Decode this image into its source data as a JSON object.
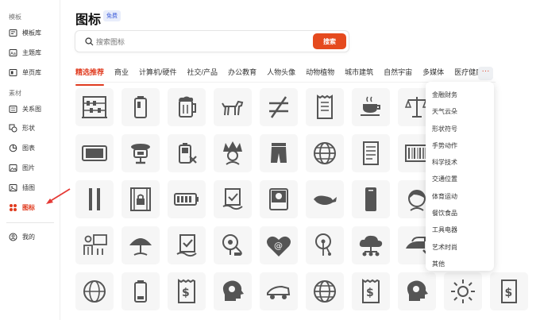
{
  "sidebar": {
    "section_templates": "模板",
    "section_materials": "素材",
    "items": [
      {
        "label": "模板库",
        "icon": "template-library-icon"
      },
      {
        "label": "主题库",
        "icon": "theme-library-icon"
      },
      {
        "label": "单页库",
        "icon": "single-page-icon"
      },
      {
        "label": "关系图",
        "icon": "relation-diagram-icon"
      },
      {
        "label": "形状",
        "icon": "shape-icon"
      },
      {
        "label": "图表",
        "icon": "chart-icon"
      },
      {
        "label": "图片",
        "icon": "image-icon"
      },
      {
        "label": "插图",
        "icon": "illustration-icon"
      },
      {
        "label": "图标",
        "icon": "icons-grid-icon",
        "active": true
      }
    ],
    "mine": {
      "label": "我的",
      "icon": "user-icon"
    }
  },
  "header": {
    "title": "图标",
    "badge": "免费"
  },
  "search": {
    "placeholder": "搜索图标",
    "button_label": "搜索"
  },
  "tabs": [
    "精选推荐",
    "商业",
    "计算机/硬件",
    "社交/产品",
    "办公教育",
    "人物头像",
    "动物植物",
    "城市建筑",
    "自然宇宙",
    "多媒体",
    "医疗健康"
  ],
  "more_label": "···",
  "dropdown_items": [
    "金融财务",
    "天气云朵",
    "形状符号",
    "手势动作",
    "科学技术",
    "交通位置",
    "体育运动",
    "餐饮食品",
    "工具电器",
    "艺术时尚",
    "其他"
  ],
  "colors": {
    "accent": "#e03b1f",
    "search_button": "#e54a1e",
    "icon_gray": "#555555",
    "tile_bg": "#f6f6f6"
  },
  "grid_icons": [
    [
      "abacus-icon",
      "battery-icon",
      "beer-mug-icon",
      "dog-icon",
      "not-equal-icon",
      "receipt-icon",
      "coffee-cup-icon",
      "scale-icon",
      "medal-icon"
    ],
    [
      "tablet-icon",
      "robot-icon",
      "battery-x-icon",
      "native-chief-icon",
      "shorts-icon",
      "globe-icon",
      "document-icon",
      "barcode-icon",
      "umbrella-coins-icon"
    ],
    [
      "bars-icon",
      "locked-door-icon",
      "battery-level-icon",
      "certificate-icon",
      "photo-icon",
      "whale-icon",
      "phone-icon",
      "woman-icon",
      "iron-icon"
    ],
    [
      "teacher-board-icon",
      "beach-umbrella-icon",
      "certificate-check-icon",
      "brain-gear-icon",
      "heart-at-icon",
      "brain-circuit-icon",
      "cloud-network-icon",
      "iron-hand-icon",
      "dollar-receipt-icon"
    ],
    [
      "globe-outline-icon",
      "battery-low-icon",
      "receipt-dollar-icon",
      "head-gear-icon",
      "wagon-icon",
      "globe-alt-icon",
      "receipt-alt-icon",
      "head-gear-alt-icon",
      "sun-icon",
      "dollar-note-icon"
    ]
  ]
}
